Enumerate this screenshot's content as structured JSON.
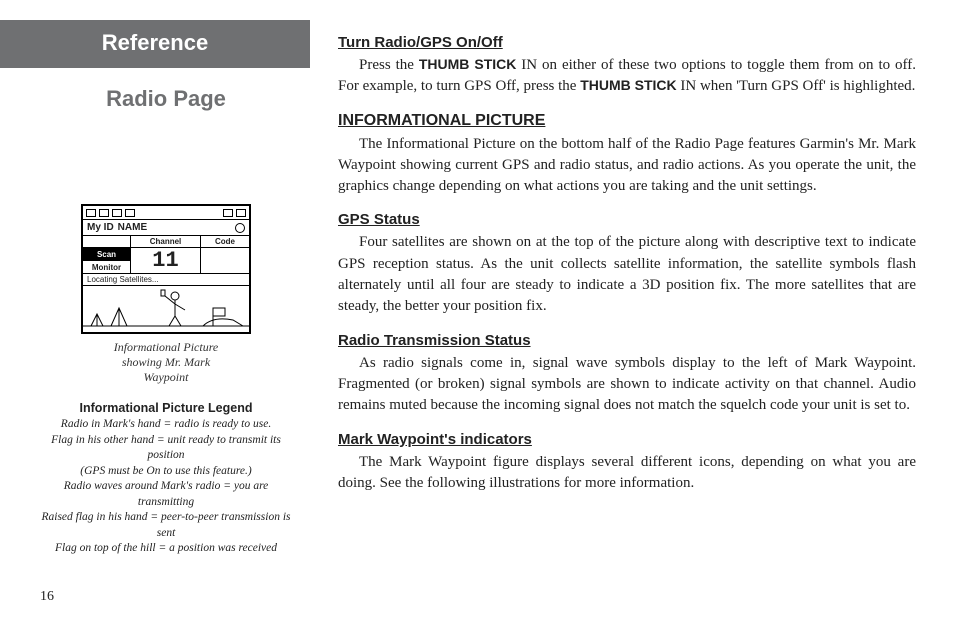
{
  "page_number": "16",
  "left": {
    "reference_banner": "Reference",
    "page_title": "Radio Page",
    "device": {
      "id_label": "My ID",
      "id_value": "NAME",
      "col_channel": "Channel",
      "col_code": "Code",
      "btn_scan": "Scan",
      "btn_monitor": "Monitor",
      "channel_value": "11",
      "status_text": "Locating Satellites..."
    },
    "figure_caption_l1": "Informational Picture",
    "figure_caption_l2": "showing Mr. Mark",
    "figure_caption_l3": "Waypoint",
    "legend_title": "Informational Picture Legend",
    "legend_lines": {
      "l1": "Radio in Mark's hand = radio is ready to use.",
      "l2": "Flag in his other hand = unit ready to transmit its position",
      "l3": "(GPS must be On to use this feature.)",
      "l4": "Radio waves around Mark's radio = you are transmitting",
      "l5": "Raised flag in his hand =  peer-to-peer transmission is sent",
      "l6": "Flag on top of the hill =  a position was received"
    }
  },
  "right": {
    "h_turn": "Turn Radio/GPS On/Off",
    "p_turn_a": "Press the ",
    "p_turn_bold1": "THUMB STICK",
    "p_turn_b": " IN on either of these two options to toggle them from on to off.  For example, to turn GPS Off, press the ",
    "p_turn_bold2": "THUMB STICK",
    "p_turn_c": " IN when 'Turn GPS Off' is highlighted.",
    "h_info": "INFORMATIONAL PICTURE",
    "p_info": "The Informational Picture on the bottom half of the Radio Page features Garmin's Mr. Mark Waypoint showing current GPS and radio status, and radio actions.  As you operate the unit, the graphics change depending on what actions you are taking and the unit settings.",
    "h_gps": "GPS Status",
    "p_gps": "Four satellites are shown on at the top of the picture along with descriptive text to indicate GPS reception status.  As the unit collects satellite information, the satellite symbols flash alternately until all four are steady to indicate a 3D position fix.  The more satellites that are steady, the better your position fix.",
    "h_radio": "Radio Transmission Status",
    "p_radio": "As radio signals come in, signal wave symbols display to the left of Mark Waypoint.  Fragmented (or broken) signal symbols are shown to indicate activity on that channel.  Audio remains muted because the incoming signal does not match the squelch code your unit is set to.",
    "h_mark": "Mark Waypoint's indicators",
    "p_mark": "The Mark Waypoint figure displays several different icons, depending on what you are doing.  See the following illustrations for more information."
  }
}
